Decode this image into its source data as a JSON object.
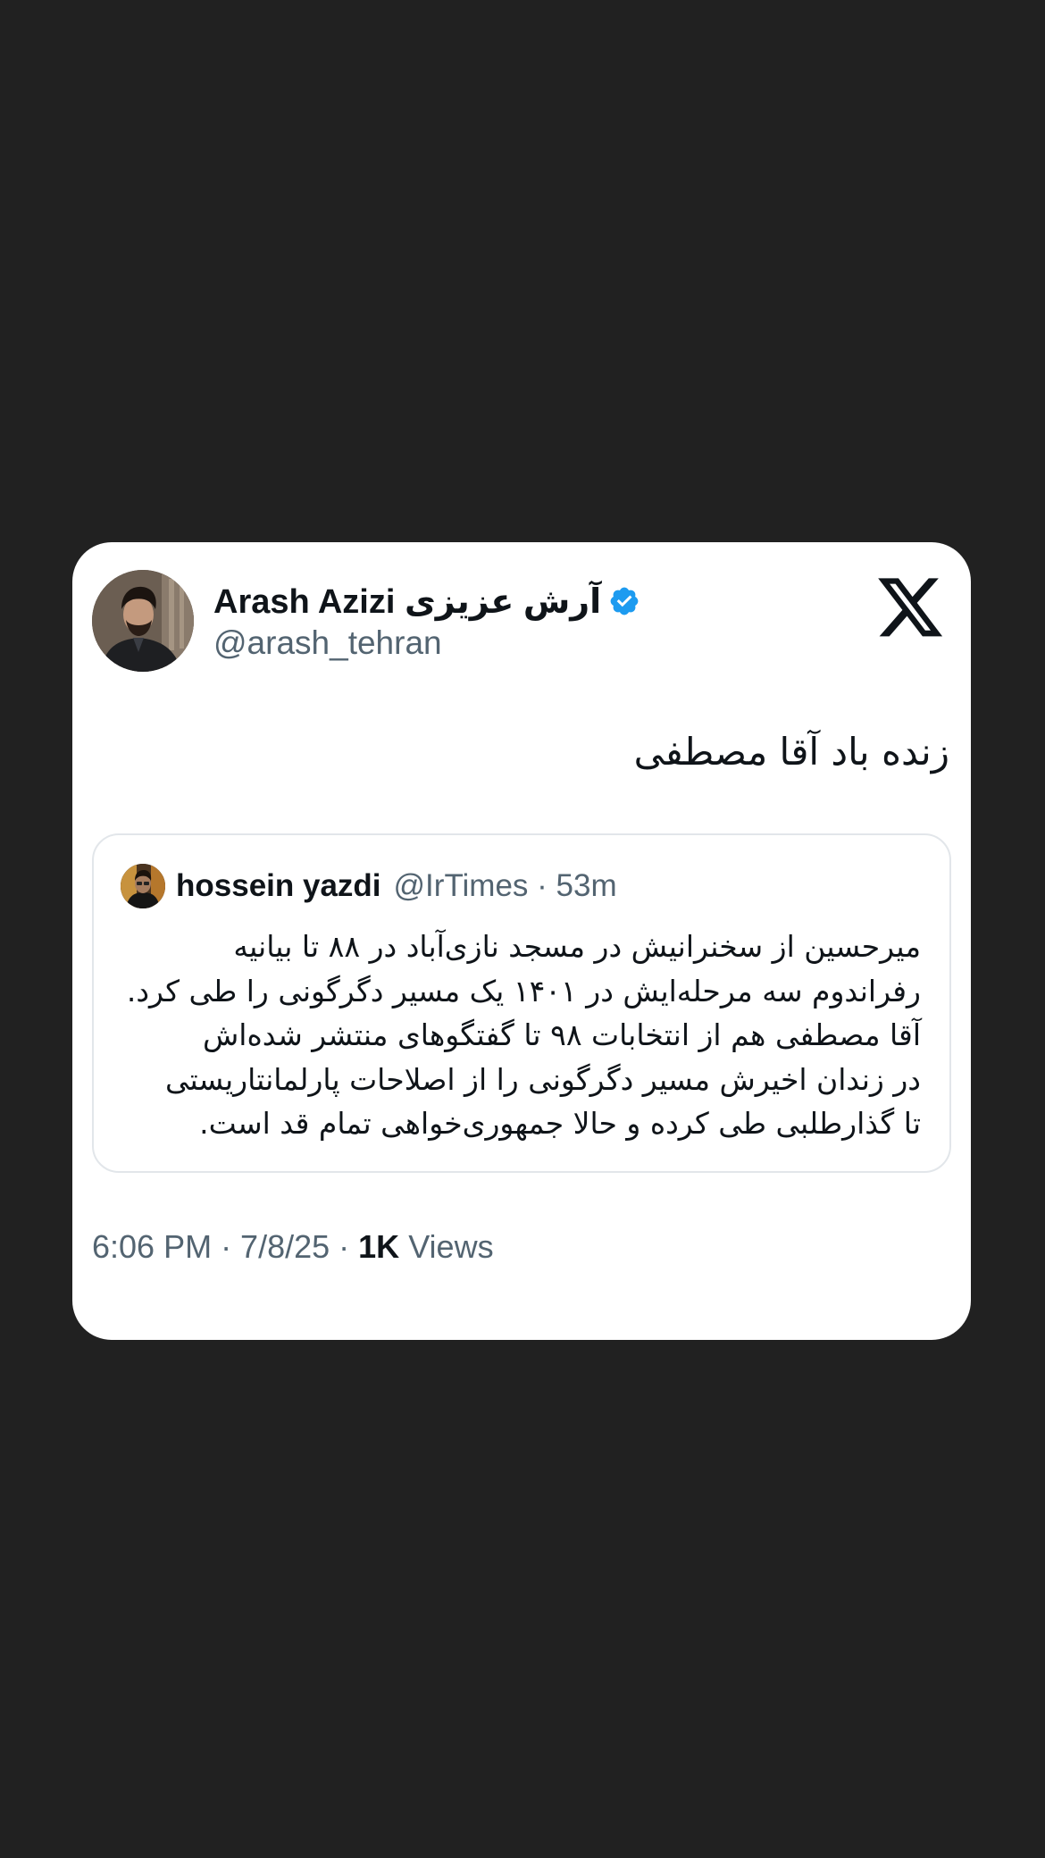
{
  "author": {
    "display_name": "Arash Azizi آرش عزیزی",
    "handle": "@arash_tehran",
    "verified": true,
    "avatar_icon": "profile-photo"
  },
  "brand_icon": "x-logo-icon",
  "tweet": {
    "text": "زنده باد آقا مصطفی"
  },
  "quoted_tweet": {
    "name": "hossein yazdi",
    "meta": "@IrTimes · 53m",
    "lines": [
      "میرحسین از سخنرانیش در مسجد نازی‌آباد در ۸۸ تا بیانیه",
      "رفراندوم سه مرحله‌ایش در ۱۴۰۱ یک مسیر دگرگونی را طی کرد.",
      "آقا مصطفی هم از انتخابات ۹۸ تا گفتگوهای منتشر شده‌اش",
      "در زندان اخیرش مسیر دگرگونی را از اصلاحات پارلمانتاریستی",
      "تا گذارطلبی طی کرده و حالا جمهوری‌خواهی تمام قد است."
    ]
  },
  "footer": {
    "timestamp": "6:06 PM · 7/8/25 · ",
    "views_count": "1K",
    "views_label": " Views"
  },
  "colors": {
    "background": "#212121",
    "card": "#ffffff",
    "verified_badge": "#1d9bf0",
    "secondary_text": "#536471",
    "primary_text": "#0f1419"
  }
}
